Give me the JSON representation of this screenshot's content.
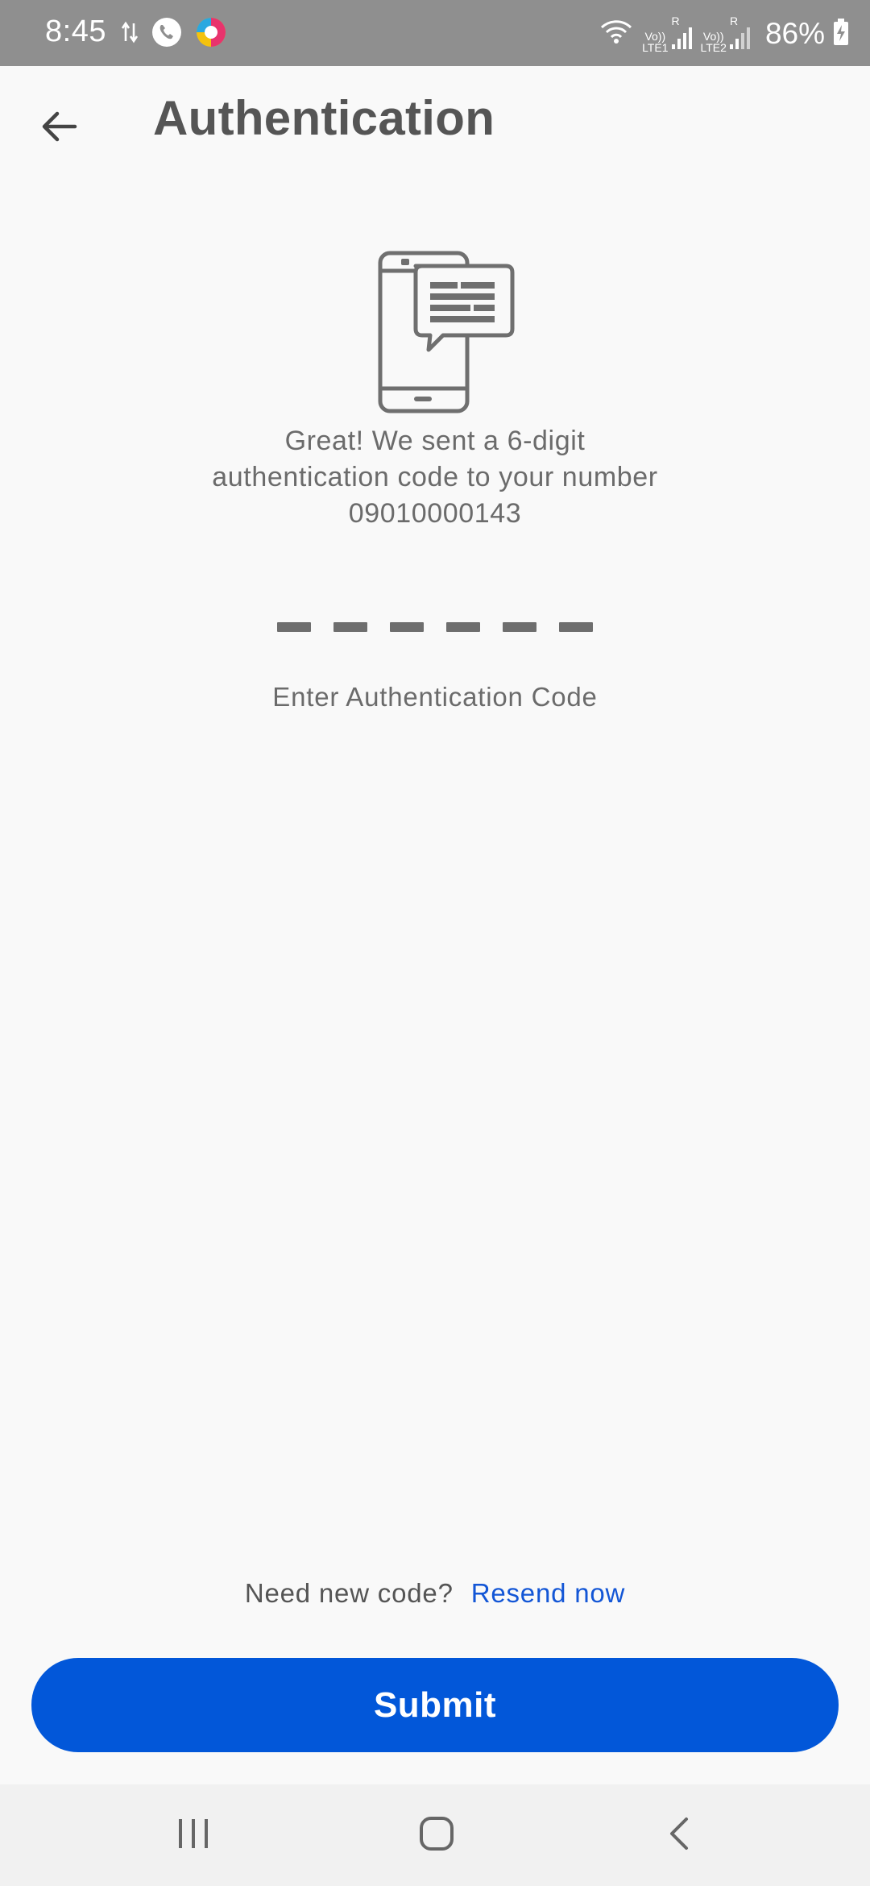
{
  "status_bar": {
    "time": "8:45",
    "network_1": "LTE1",
    "network_2": "LTE2",
    "volte_1": "Vo))",
    "volte_2": "Vo))",
    "roaming_1": "R",
    "roaming_2": "R",
    "battery": "86%",
    "left_icons": [
      "data-transfer-icon",
      "phone-call-icon",
      "app-notification-icon"
    ],
    "right_icons": [
      "wifi-icon",
      "signal-icon",
      "signal-icon",
      "battery-charging-icon"
    ]
  },
  "header": {
    "title": "Authentication",
    "back_icon": "arrow-left-icon"
  },
  "illustration": {
    "icon": "phone-message-icon"
  },
  "message": {
    "line1": "Great! We sent a 6-digit",
    "line2": "authentication code to your number",
    "phone_number": "09010000143"
  },
  "code_input": {
    "digits": [
      "",
      "",
      "",
      "",
      "",
      ""
    ],
    "label": "Enter Authentication Code"
  },
  "resend": {
    "prompt": "Need new code?",
    "link": "Resend now"
  },
  "submit": {
    "label": "Submit"
  },
  "colors": {
    "primary": "#0257d9",
    "link": "#1356d6",
    "status_bar": "#8f8f8f",
    "text_muted": "#6b6b6b",
    "background": "#f9f9f9"
  },
  "nav_bar": {
    "icons": [
      "recent-apps-icon",
      "home-icon",
      "back-icon"
    ]
  }
}
